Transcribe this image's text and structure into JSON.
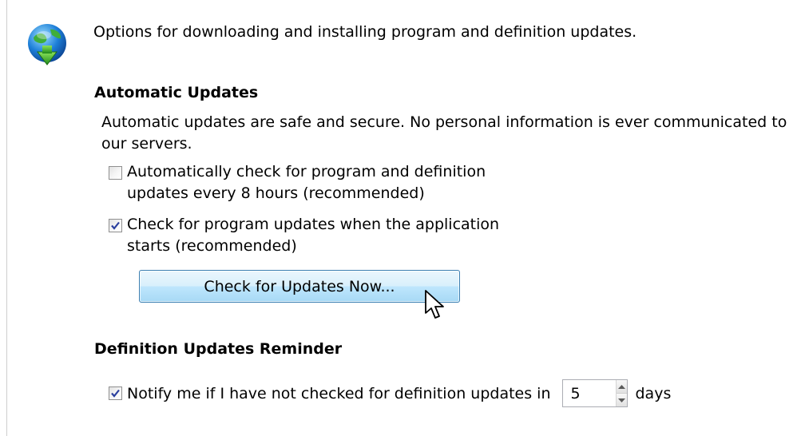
{
  "intro_text": "Options for downloading and installing program and definition updates.",
  "automatic_updates": {
    "title": "Automatic Updates",
    "description": "Automatic updates are safe and secure. No personal information is ever communicated to our servers.",
    "options": [
      {
        "line1": "Automatically check for program and definition",
        "line2": "updates every 8 hours (recommended)",
        "checked": false
      },
      {
        "line1": "Check for program updates when the application",
        "line2": "starts (recommended)",
        "checked": true
      }
    ],
    "check_now_button": "Check for Updates Now..."
  },
  "reminder": {
    "title": "Definition Updates Reminder",
    "label": "Notify me if I have not checked for definition updates in",
    "checked": true,
    "days_value": "5",
    "days_unit": "days"
  },
  "icons": {
    "header": "globe-download-icon",
    "cursor": "mouse-cursor-icon"
  }
}
